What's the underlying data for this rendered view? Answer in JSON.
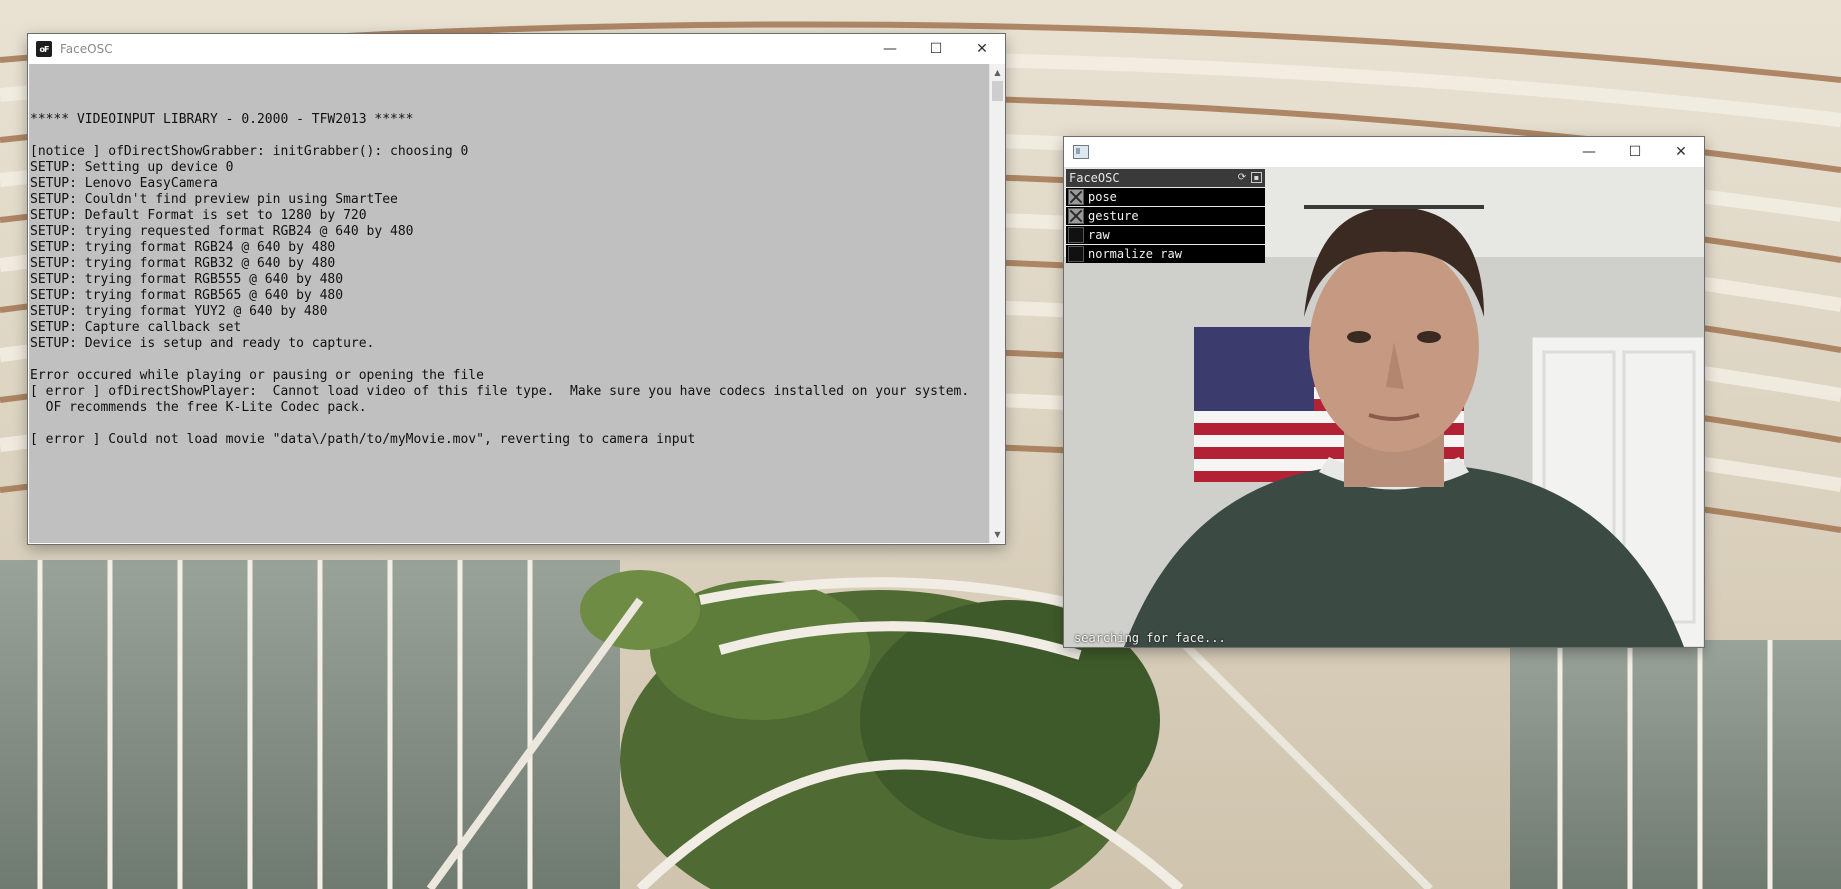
{
  "console_window": {
    "title": "FaceOSC",
    "icon": "openframeworks-logo",
    "lines": [
      "",
      "***** VIDEOINPUT LIBRARY - 0.2000 - TFW2013 *****",
      "",
      "[notice ] ofDirectShowGrabber: initGrabber(): choosing 0",
      "SETUP: Setting up device 0",
      "SETUP: Lenovo EasyCamera",
      "SETUP: Couldn't find preview pin using SmartTee",
      "SETUP: Default Format is set to 1280 by 720",
      "SETUP: trying requested format RGB24 @ 640 by 480",
      "SETUP: trying format RGB24 @ 640 by 480",
      "SETUP: trying format RGB32 @ 640 by 480",
      "SETUP: trying format RGB555 @ 640 by 480",
      "SETUP: trying format RGB565 @ 640 by 480",
      "SETUP: trying format YUY2 @ 640 by 480",
      "SETUP: Capture callback set",
      "SETUP: Device is setup and ready to capture.",
      "",
      "Error occured while playing or pausing or opening the file",
      "[ error ] ofDirectShowPlayer:  Cannot load video of this file type.  Make sure you have codecs installed on your system.",
      "  OF recommends the free K-Lite Codec pack.",
      "",
      "[ error ] Could not load movie \"data\\/path/to/myMovie.mov\", reverting to camera input"
    ]
  },
  "app_window": {
    "icon": "window-app-icon",
    "gui": {
      "title": "FaceOSC",
      "icons": [
        "refresh-icon",
        "save-icon"
      ],
      "toggles": [
        {
          "label": "pose",
          "checked": true
        },
        {
          "label": "gesture",
          "checked": true
        },
        {
          "label": "raw",
          "checked": false
        },
        {
          "label": "normalize raw",
          "checked": false
        }
      ]
    },
    "status": "searching for face..."
  },
  "caption_buttons": {
    "minimize": "—",
    "maximize": "☐",
    "close": "✕"
  },
  "colors": {
    "console_bg": "#c0c0c0",
    "gui_row_bg": "#000000",
    "gui_header_bg": "#3a3a3a"
  }
}
